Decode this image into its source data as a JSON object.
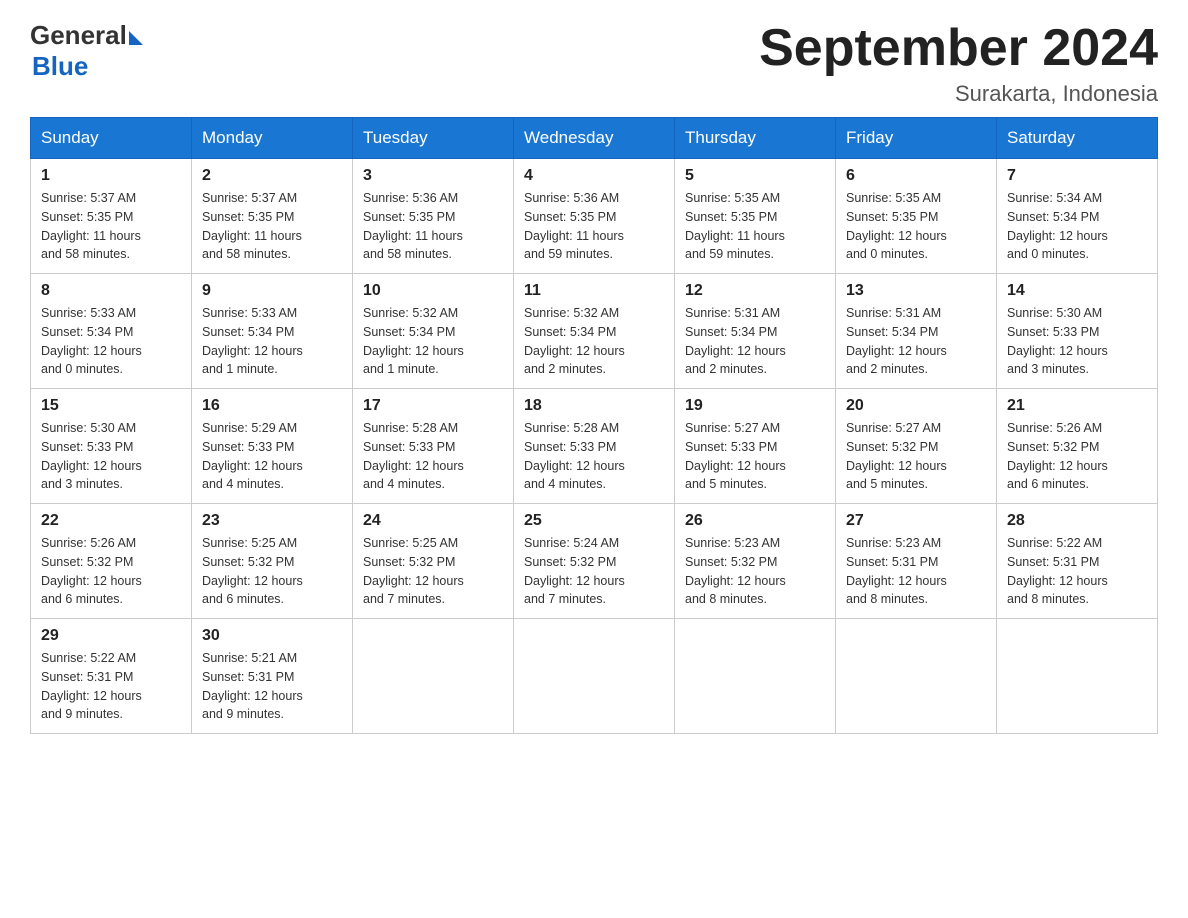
{
  "header": {
    "logo_general": "General",
    "logo_blue": "Blue",
    "title": "September 2024",
    "subtitle": "Surakarta, Indonesia"
  },
  "weekdays": [
    "Sunday",
    "Monday",
    "Tuesday",
    "Wednesday",
    "Thursday",
    "Friday",
    "Saturday"
  ],
  "weeks": [
    [
      {
        "day": "1",
        "line1": "Sunrise: 5:37 AM",
        "line2": "Sunset: 5:35 PM",
        "line3": "Daylight: 11 hours",
        "line4": "and 58 minutes."
      },
      {
        "day": "2",
        "line1": "Sunrise: 5:37 AM",
        "line2": "Sunset: 5:35 PM",
        "line3": "Daylight: 11 hours",
        "line4": "and 58 minutes."
      },
      {
        "day": "3",
        "line1": "Sunrise: 5:36 AM",
        "line2": "Sunset: 5:35 PM",
        "line3": "Daylight: 11 hours",
        "line4": "and 58 minutes."
      },
      {
        "day": "4",
        "line1": "Sunrise: 5:36 AM",
        "line2": "Sunset: 5:35 PM",
        "line3": "Daylight: 11 hours",
        "line4": "and 59 minutes."
      },
      {
        "day": "5",
        "line1": "Sunrise: 5:35 AM",
        "line2": "Sunset: 5:35 PM",
        "line3": "Daylight: 11 hours",
        "line4": "and 59 minutes."
      },
      {
        "day": "6",
        "line1": "Sunrise: 5:35 AM",
        "line2": "Sunset: 5:35 PM",
        "line3": "Daylight: 12 hours",
        "line4": "and 0 minutes."
      },
      {
        "day": "7",
        "line1": "Sunrise: 5:34 AM",
        "line2": "Sunset: 5:34 PM",
        "line3": "Daylight: 12 hours",
        "line4": "and 0 minutes."
      }
    ],
    [
      {
        "day": "8",
        "line1": "Sunrise: 5:33 AM",
        "line2": "Sunset: 5:34 PM",
        "line3": "Daylight: 12 hours",
        "line4": "and 0 minutes."
      },
      {
        "day": "9",
        "line1": "Sunrise: 5:33 AM",
        "line2": "Sunset: 5:34 PM",
        "line3": "Daylight: 12 hours",
        "line4": "and 1 minute."
      },
      {
        "day": "10",
        "line1": "Sunrise: 5:32 AM",
        "line2": "Sunset: 5:34 PM",
        "line3": "Daylight: 12 hours",
        "line4": "and 1 minute."
      },
      {
        "day": "11",
        "line1": "Sunrise: 5:32 AM",
        "line2": "Sunset: 5:34 PM",
        "line3": "Daylight: 12 hours",
        "line4": "and 2 minutes."
      },
      {
        "day": "12",
        "line1": "Sunrise: 5:31 AM",
        "line2": "Sunset: 5:34 PM",
        "line3": "Daylight: 12 hours",
        "line4": "and 2 minutes."
      },
      {
        "day": "13",
        "line1": "Sunrise: 5:31 AM",
        "line2": "Sunset: 5:34 PM",
        "line3": "Daylight: 12 hours",
        "line4": "and 2 minutes."
      },
      {
        "day": "14",
        "line1": "Sunrise: 5:30 AM",
        "line2": "Sunset: 5:33 PM",
        "line3": "Daylight: 12 hours",
        "line4": "and 3 minutes."
      }
    ],
    [
      {
        "day": "15",
        "line1": "Sunrise: 5:30 AM",
        "line2": "Sunset: 5:33 PM",
        "line3": "Daylight: 12 hours",
        "line4": "and 3 minutes."
      },
      {
        "day": "16",
        "line1": "Sunrise: 5:29 AM",
        "line2": "Sunset: 5:33 PM",
        "line3": "Daylight: 12 hours",
        "line4": "and 4 minutes."
      },
      {
        "day": "17",
        "line1": "Sunrise: 5:28 AM",
        "line2": "Sunset: 5:33 PM",
        "line3": "Daylight: 12 hours",
        "line4": "and 4 minutes."
      },
      {
        "day": "18",
        "line1": "Sunrise: 5:28 AM",
        "line2": "Sunset: 5:33 PM",
        "line3": "Daylight: 12 hours",
        "line4": "and 4 minutes."
      },
      {
        "day": "19",
        "line1": "Sunrise: 5:27 AM",
        "line2": "Sunset: 5:33 PM",
        "line3": "Daylight: 12 hours",
        "line4": "and 5 minutes."
      },
      {
        "day": "20",
        "line1": "Sunrise: 5:27 AM",
        "line2": "Sunset: 5:32 PM",
        "line3": "Daylight: 12 hours",
        "line4": "and 5 minutes."
      },
      {
        "day": "21",
        "line1": "Sunrise: 5:26 AM",
        "line2": "Sunset: 5:32 PM",
        "line3": "Daylight: 12 hours",
        "line4": "and 6 minutes."
      }
    ],
    [
      {
        "day": "22",
        "line1": "Sunrise: 5:26 AM",
        "line2": "Sunset: 5:32 PM",
        "line3": "Daylight: 12 hours",
        "line4": "and 6 minutes."
      },
      {
        "day": "23",
        "line1": "Sunrise: 5:25 AM",
        "line2": "Sunset: 5:32 PM",
        "line3": "Daylight: 12 hours",
        "line4": "and 6 minutes."
      },
      {
        "day": "24",
        "line1": "Sunrise: 5:25 AM",
        "line2": "Sunset: 5:32 PM",
        "line3": "Daylight: 12 hours",
        "line4": "and 7 minutes."
      },
      {
        "day": "25",
        "line1": "Sunrise: 5:24 AM",
        "line2": "Sunset: 5:32 PM",
        "line3": "Daylight: 12 hours",
        "line4": "and 7 minutes."
      },
      {
        "day": "26",
        "line1": "Sunrise: 5:23 AM",
        "line2": "Sunset: 5:32 PM",
        "line3": "Daylight: 12 hours",
        "line4": "and 8 minutes."
      },
      {
        "day": "27",
        "line1": "Sunrise: 5:23 AM",
        "line2": "Sunset: 5:31 PM",
        "line3": "Daylight: 12 hours",
        "line4": "and 8 minutes."
      },
      {
        "day": "28",
        "line1": "Sunrise: 5:22 AM",
        "line2": "Sunset: 5:31 PM",
        "line3": "Daylight: 12 hours",
        "line4": "and 8 minutes."
      }
    ],
    [
      {
        "day": "29",
        "line1": "Sunrise: 5:22 AM",
        "line2": "Sunset: 5:31 PM",
        "line3": "Daylight: 12 hours",
        "line4": "and 9 minutes."
      },
      {
        "day": "30",
        "line1": "Sunrise: 5:21 AM",
        "line2": "Sunset: 5:31 PM",
        "line3": "Daylight: 12 hours",
        "line4": "and 9 minutes."
      },
      null,
      null,
      null,
      null,
      null
    ]
  ]
}
